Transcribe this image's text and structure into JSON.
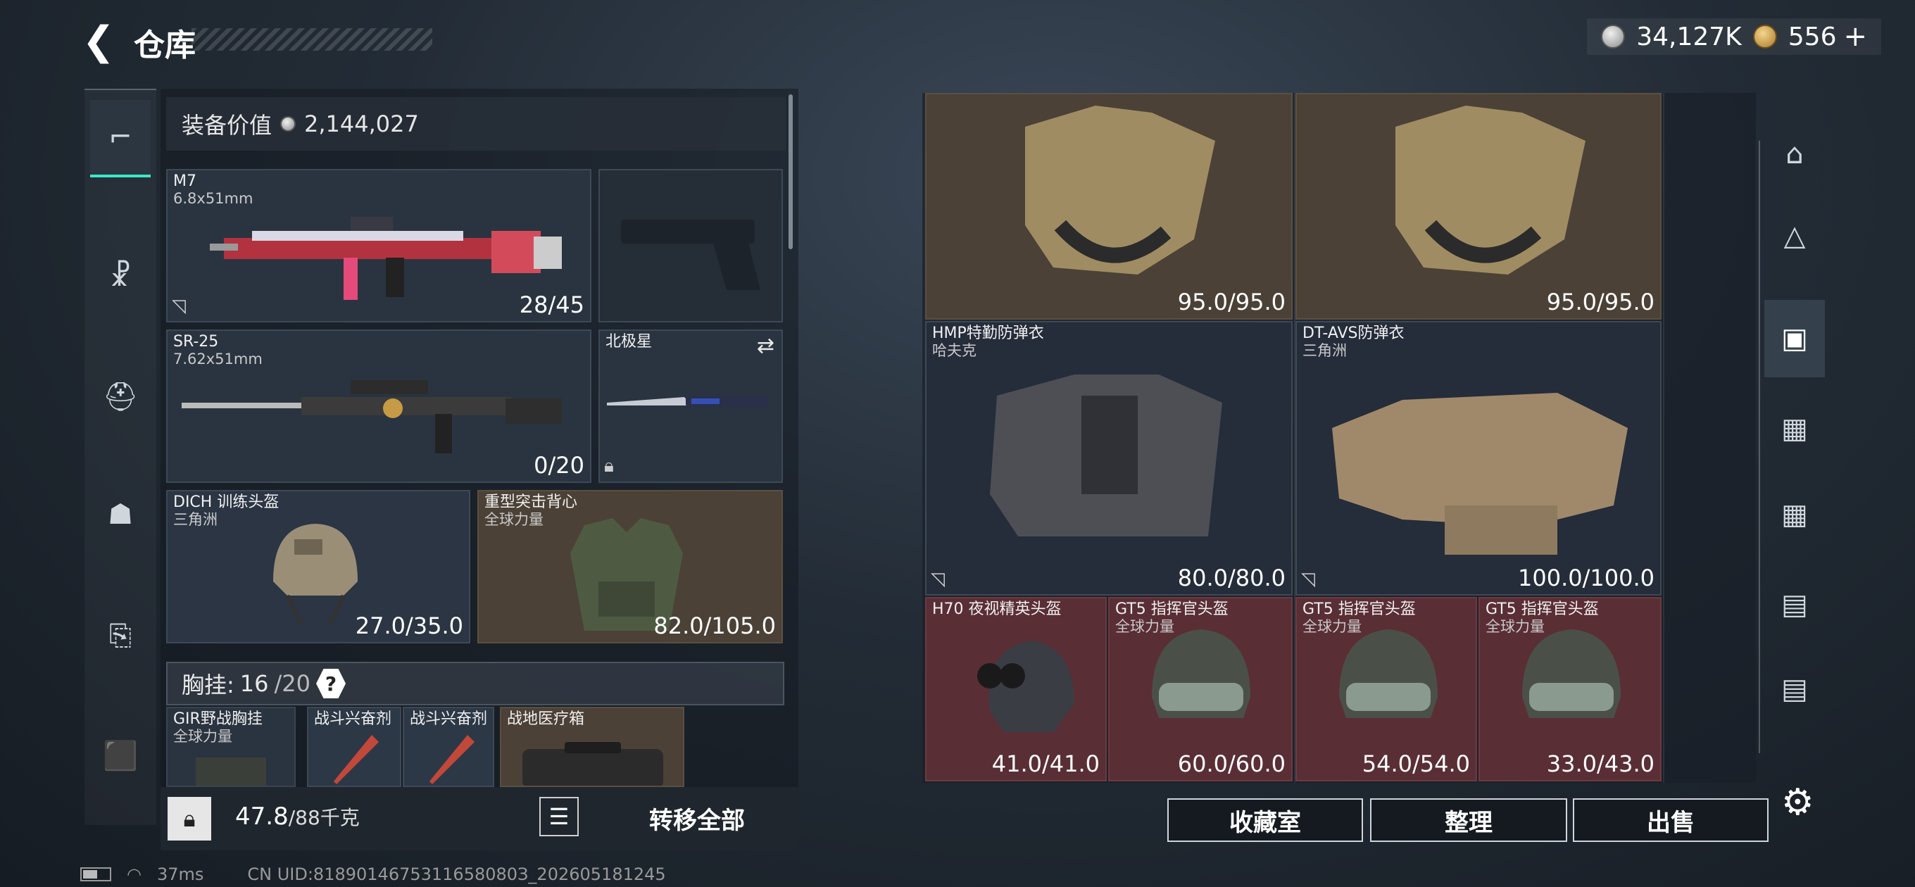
{
  "header": {
    "title": "仓库",
    "silver": "34,127K",
    "gold": "556",
    "plus": "+"
  },
  "loadout": {
    "equip_value_label": "装备价值",
    "equip_value": "2,144,027",
    "primary": {
      "name": "M7",
      "caliber": "6.8x51mm",
      "ammo": "28/45"
    },
    "secondary": {
      "name": "SR-25",
      "caliber": "7.62x51mm",
      "ammo": "0/20"
    },
    "melee": {
      "name": "北极星"
    },
    "helmet": {
      "name": "DICH 训练头盔",
      "faction": "三角洲",
      "durability": "27.0/35.0"
    },
    "armor": {
      "name": "重型突击背心",
      "faction": "全球力量",
      "durability": "82.0/105.0"
    },
    "rig": {
      "label": "胸挂:",
      "used": "16",
      "total": "/20",
      "help": "?"
    },
    "rig_items": [
      {
        "name": "GIR野战胸挂",
        "sub": "全球力量"
      },
      {
        "name": "战斗兴奋剂",
        "sub": ""
      },
      {
        "name": "战斗兴奋剂",
        "sub": ""
      },
      {
        "name": "战地医疗箱",
        "sub": ""
      }
    ],
    "weight": "47.8",
    "weight_max": "/88千克",
    "transfer": "转移全部"
  },
  "stash": {
    "items": [
      {
        "name": "",
        "sub": "",
        "durability": "95.0/95.0"
      },
      {
        "name": "",
        "sub": "",
        "durability": "95.0/95.0"
      },
      {
        "name": "HMP特勤防弹衣",
        "sub": "哈夫克",
        "durability": "80.0/80.0"
      },
      {
        "name": "DT-AVS防弹衣",
        "sub": "三角洲",
        "durability": "100.0/100.0"
      },
      {
        "name": "H70 夜视精英头盔",
        "sub": "",
        "durability": "41.0/41.0"
      },
      {
        "name": "GT5 指挥官头盔",
        "sub": "全球力量",
        "durability": "60.0/60.0"
      },
      {
        "name": "GT5 指挥官头盔",
        "sub": "全球力量",
        "durability": "54.0/54.0"
      },
      {
        "name": "GT5 指挥官头盔",
        "sub": "全球力量",
        "durability": "33.0/43.0"
      }
    ],
    "buttons": {
      "collection": "收藏室",
      "sort": "整理",
      "sell": "出售"
    }
  },
  "status": {
    "ping": "37ms",
    "uid": "CN UID:8189014675311658080З_202605181245"
  }
}
